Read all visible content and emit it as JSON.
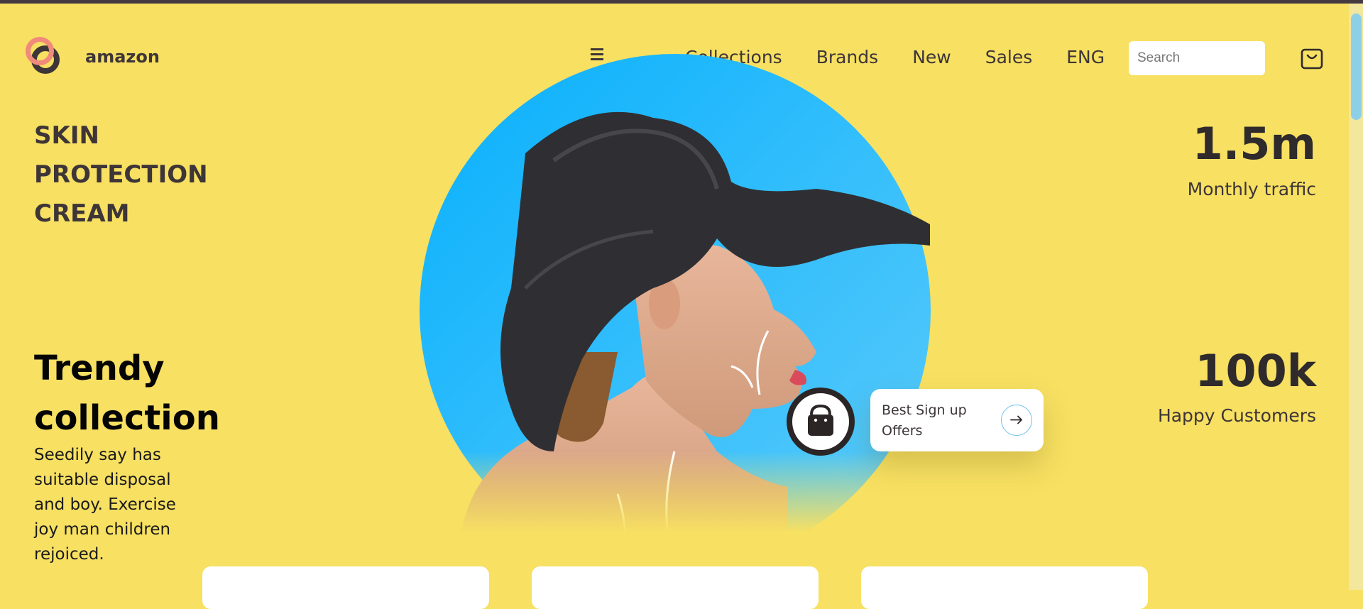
{
  "brand": {
    "name": "amazon"
  },
  "nav": {
    "items": [
      "Collections",
      "Brands",
      "New",
      "Sales",
      "ENG"
    ],
    "search_placeholder": "Search"
  },
  "hero": {
    "lines": [
      "SKIN",
      "PROTECTION",
      "CREAM"
    ],
    "trendy_title": "Trendy collection",
    "description": "Seedily say has suitable disposal and boy. Exercise joy man children rejoiced."
  },
  "offer": {
    "text": "Best Sign up Offers"
  },
  "stats": [
    {
      "value": "1.5m",
      "label": "Monthly traffic"
    },
    {
      "value": "100k",
      "label": "Happy Customers"
    }
  ],
  "colors": {
    "background": "#f7e062",
    "accent_blue": "#1ab3fb",
    "logo_pink": "#f08a7a",
    "dark": "#3d3537"
  },
  "icons": [
    "menu-icon",
    "cart-icon",
    "shopping-bag-icon",
    "arrow-right-icon"
  ]
}
